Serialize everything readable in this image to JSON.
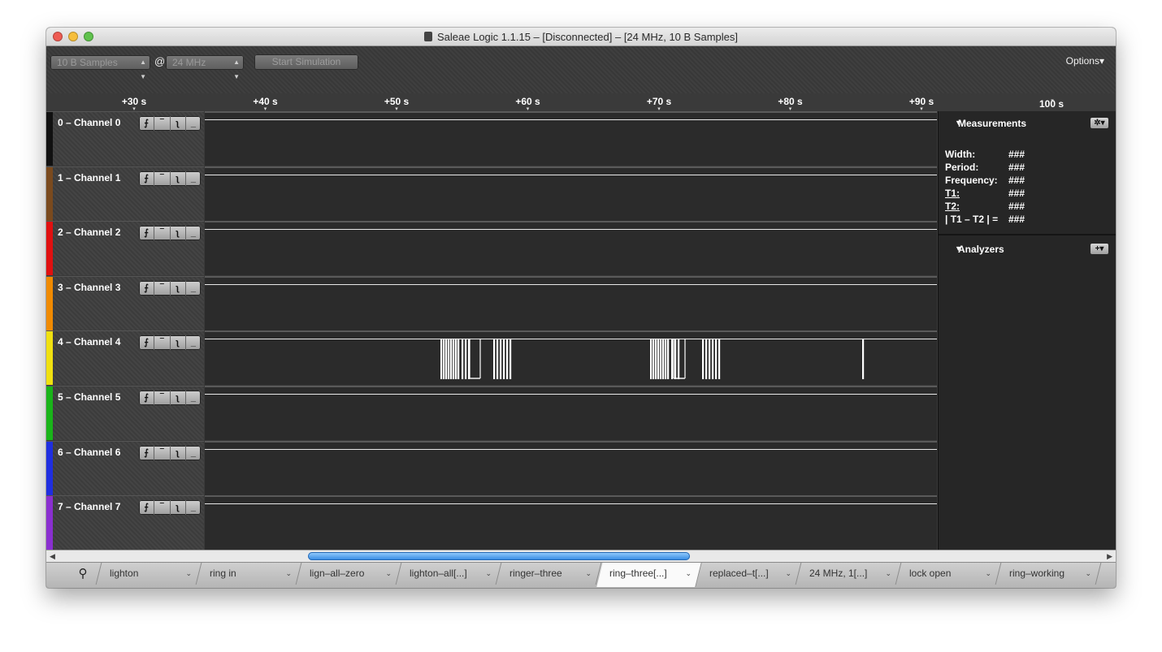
{
  "window": {
    "title": "Saleae Logic 1.1.15 – [Disconnected] – [24 MHz, 10 B Samples]"
  },
  "toolbar": {
    "samples": "10 B Samples",
    "at": "@",
    "rate": "24 MHz",
    "start_label": "Start Simulation",
    "options_label": "Options"
  },
  "ruler": {
    "top_label": "100 s",
    "ticks": [
      "+30 s",
      "+40 s",
      "+50 s",
      "+60 s",
      "+70 s",
      "+80 s",
      "+90 s"
    ]
  },
  "channels": [
    {
      "name": "0 – Channel 0",
      "color": "#111111"
    },
    {
      "name": "1 – Channel 1",
      "color": "#7a4a1e"
    },
    {
      "name": "2 – Channel 2",
      "color": "#e01010"
    },
    {
      "name": "3 – Channel 3",
      "color": "#f08a00"
    },
    {
      "name": "4 – Channel 4",
      "color": "#f0e010"
    },
    {
      "name": "5 – Channel 5",
      "color": "#19b419"
    },
    {
      "name": "6 – Channel 6",
      "color": "#1f2ee0"
    },
    {
      "name": "7 – Channel 7",
      "color": "#8a2fd0"
    }
  ],
  "trigger_glyphs": [
    "⨍",
    "‾",
    "ʅ",
    "_"
  ],
  "measurements": {
    "title": "Measurements",
    "rows": [
      {
        "k": "Width:",
        "v": "###"
      },
      {
        "k": "Period:",
        "v": "###"
      },
      {
        "k": "Frequency:",
        "v": "###"
      },
      {
        "k": "T1:",
        "v": "###"
      },
      {
        "k": "T2:",
        "v": "###"
      },
      {
        "k": "| T1 – T2 | =",
        "v": "###"
      }
    ]
  },
  "analyzers": {
    "title": "Analyzers"
  },
  "tabs": [
    "lighton",
    "ring in",
    "lign–all–zero",
    "lighton–all[...]",
    "ringer–three",
    "ring–three[...]",
    "replaced–t[...]",
    "24 MHz, 1[...]",
    "lock open",
    "ring–working"
  ],
  "active_tab": 5
}
